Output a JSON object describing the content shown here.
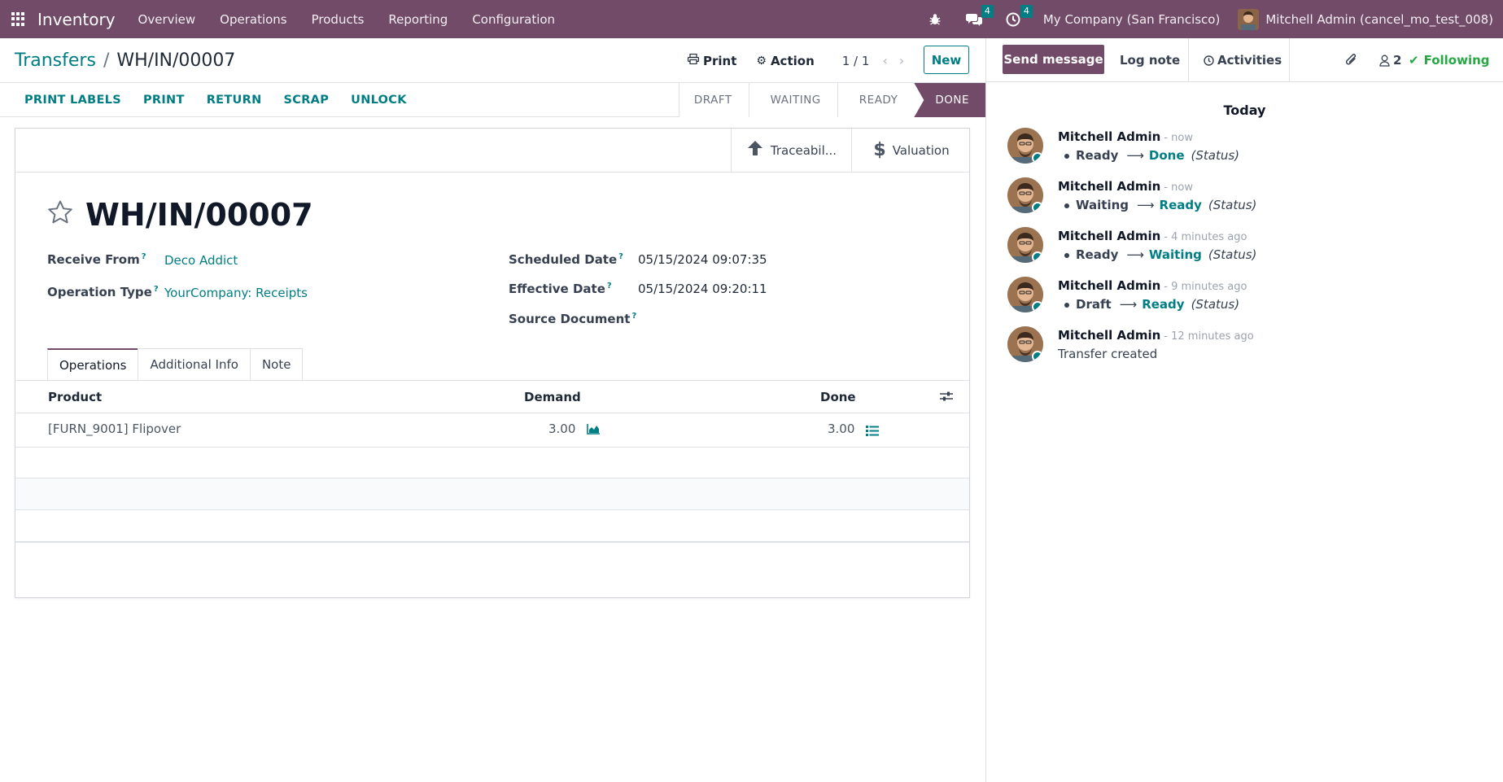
{
  "topbar": {
    "app_name": "Inventory",
    "menu": [
      "Overview",
      "Operations",
      "Products",
      "Reporting",
      "Configuration"
    ],
    "messages_badge": "4",
    "activities_badge": "4",
    "company": "My Company (San Francisco)",
    "user": "Mitchell Admin (cancel_mo_test_008)",
    "bar_color": "#714B67"
  },
  "control": {
    "breadcrumb_parent": "Transfers",
    "breadcrumb_separator": "/",
    "breadcrumb_current": "WH/IN/00007",
    "print_label": "Print",
    "action_label": "Action",
    "pager": "1 / 1",
    "new_label": "New"
  },
  "statusbar": {
    "buttons": [
      "PRINT LABELS",
      "PRINT",
      "RETURN",
      "SCRAP",
      "UNLOCK"
    ],
    "stages": [
      "DRAFT",
      "WAITING",
      "READY",
      "DONE"
    ],
    "active_stage": "DONE"
  },
  "form": {
    "smart_buttons": {
      "traceability": "Traceabil...",
      "valuation": "Valuation"
    },
    "title": "WH/IN/00007",
    "fields": {
      "receive_from_label": "Receive From",
      "receive_from_value": "Deco Addict",
      "operation_type_label": "Operation Type",
      "operation_type_value": "YourCompany: Receipts",
      "scheduled_date_label": "Scheduled Date",
      "scheduled_date_value": "05/15/2024 09:07:35",
      "effective_date_label": "Effective Date",
      "effective_date_value": "05/15/2024 09:20:11",
      "source_document_label": "Source Document",
      "help_mark": "?"
    },
    "tabs": [
      "Operations",
      "Additional Info",
      "Note"
    ],
    "table": {
      "headers": {
        "product": "Product",
        "demand": "Demand",
        "done": "Done"
      },
      "rows": [
        {
          "product": "[FURN_9001] Flipover",
          "demand": "3.00",
          "done": "3.00"
        }
      ]
    }
  },
  "chatter": {
    "send_message": "Send message",
    "log_note": "Log note",
    "activities": "Activities",
    "followers_count": "2",
    "following": "Following",
    "day_label": "Today",
    "messages": [
      {
        "author": "Mitchell Admin",
        "time": "- now",
        "old": "Ready",
        "new": "Done",
        "field": "(Status)"
      },
      {
        "author": "Mitchell Admin",
        "time": "- now",
        "old": "Waiting",
        "new": "Ready",
        "field": "(Status)"
      },
      {
        "author": "Mitchell Admin",
        "time": "- 4 minutes ago",
        "old": "Ready",
        "new": "Waiting",
        "field": "(Status)"
      },
      {
        "author": "Mitchell Admin",
        "time": "- 9 minutes ago",
        "old": "Draft",
        "new": "Ready",
        "field": "(Status)"
      },
      {
        "author": "Mitchell Admin",
        "time": "- 12 minutes ago",
        "text": "Transfer created"
      }
    ]
  }
}
